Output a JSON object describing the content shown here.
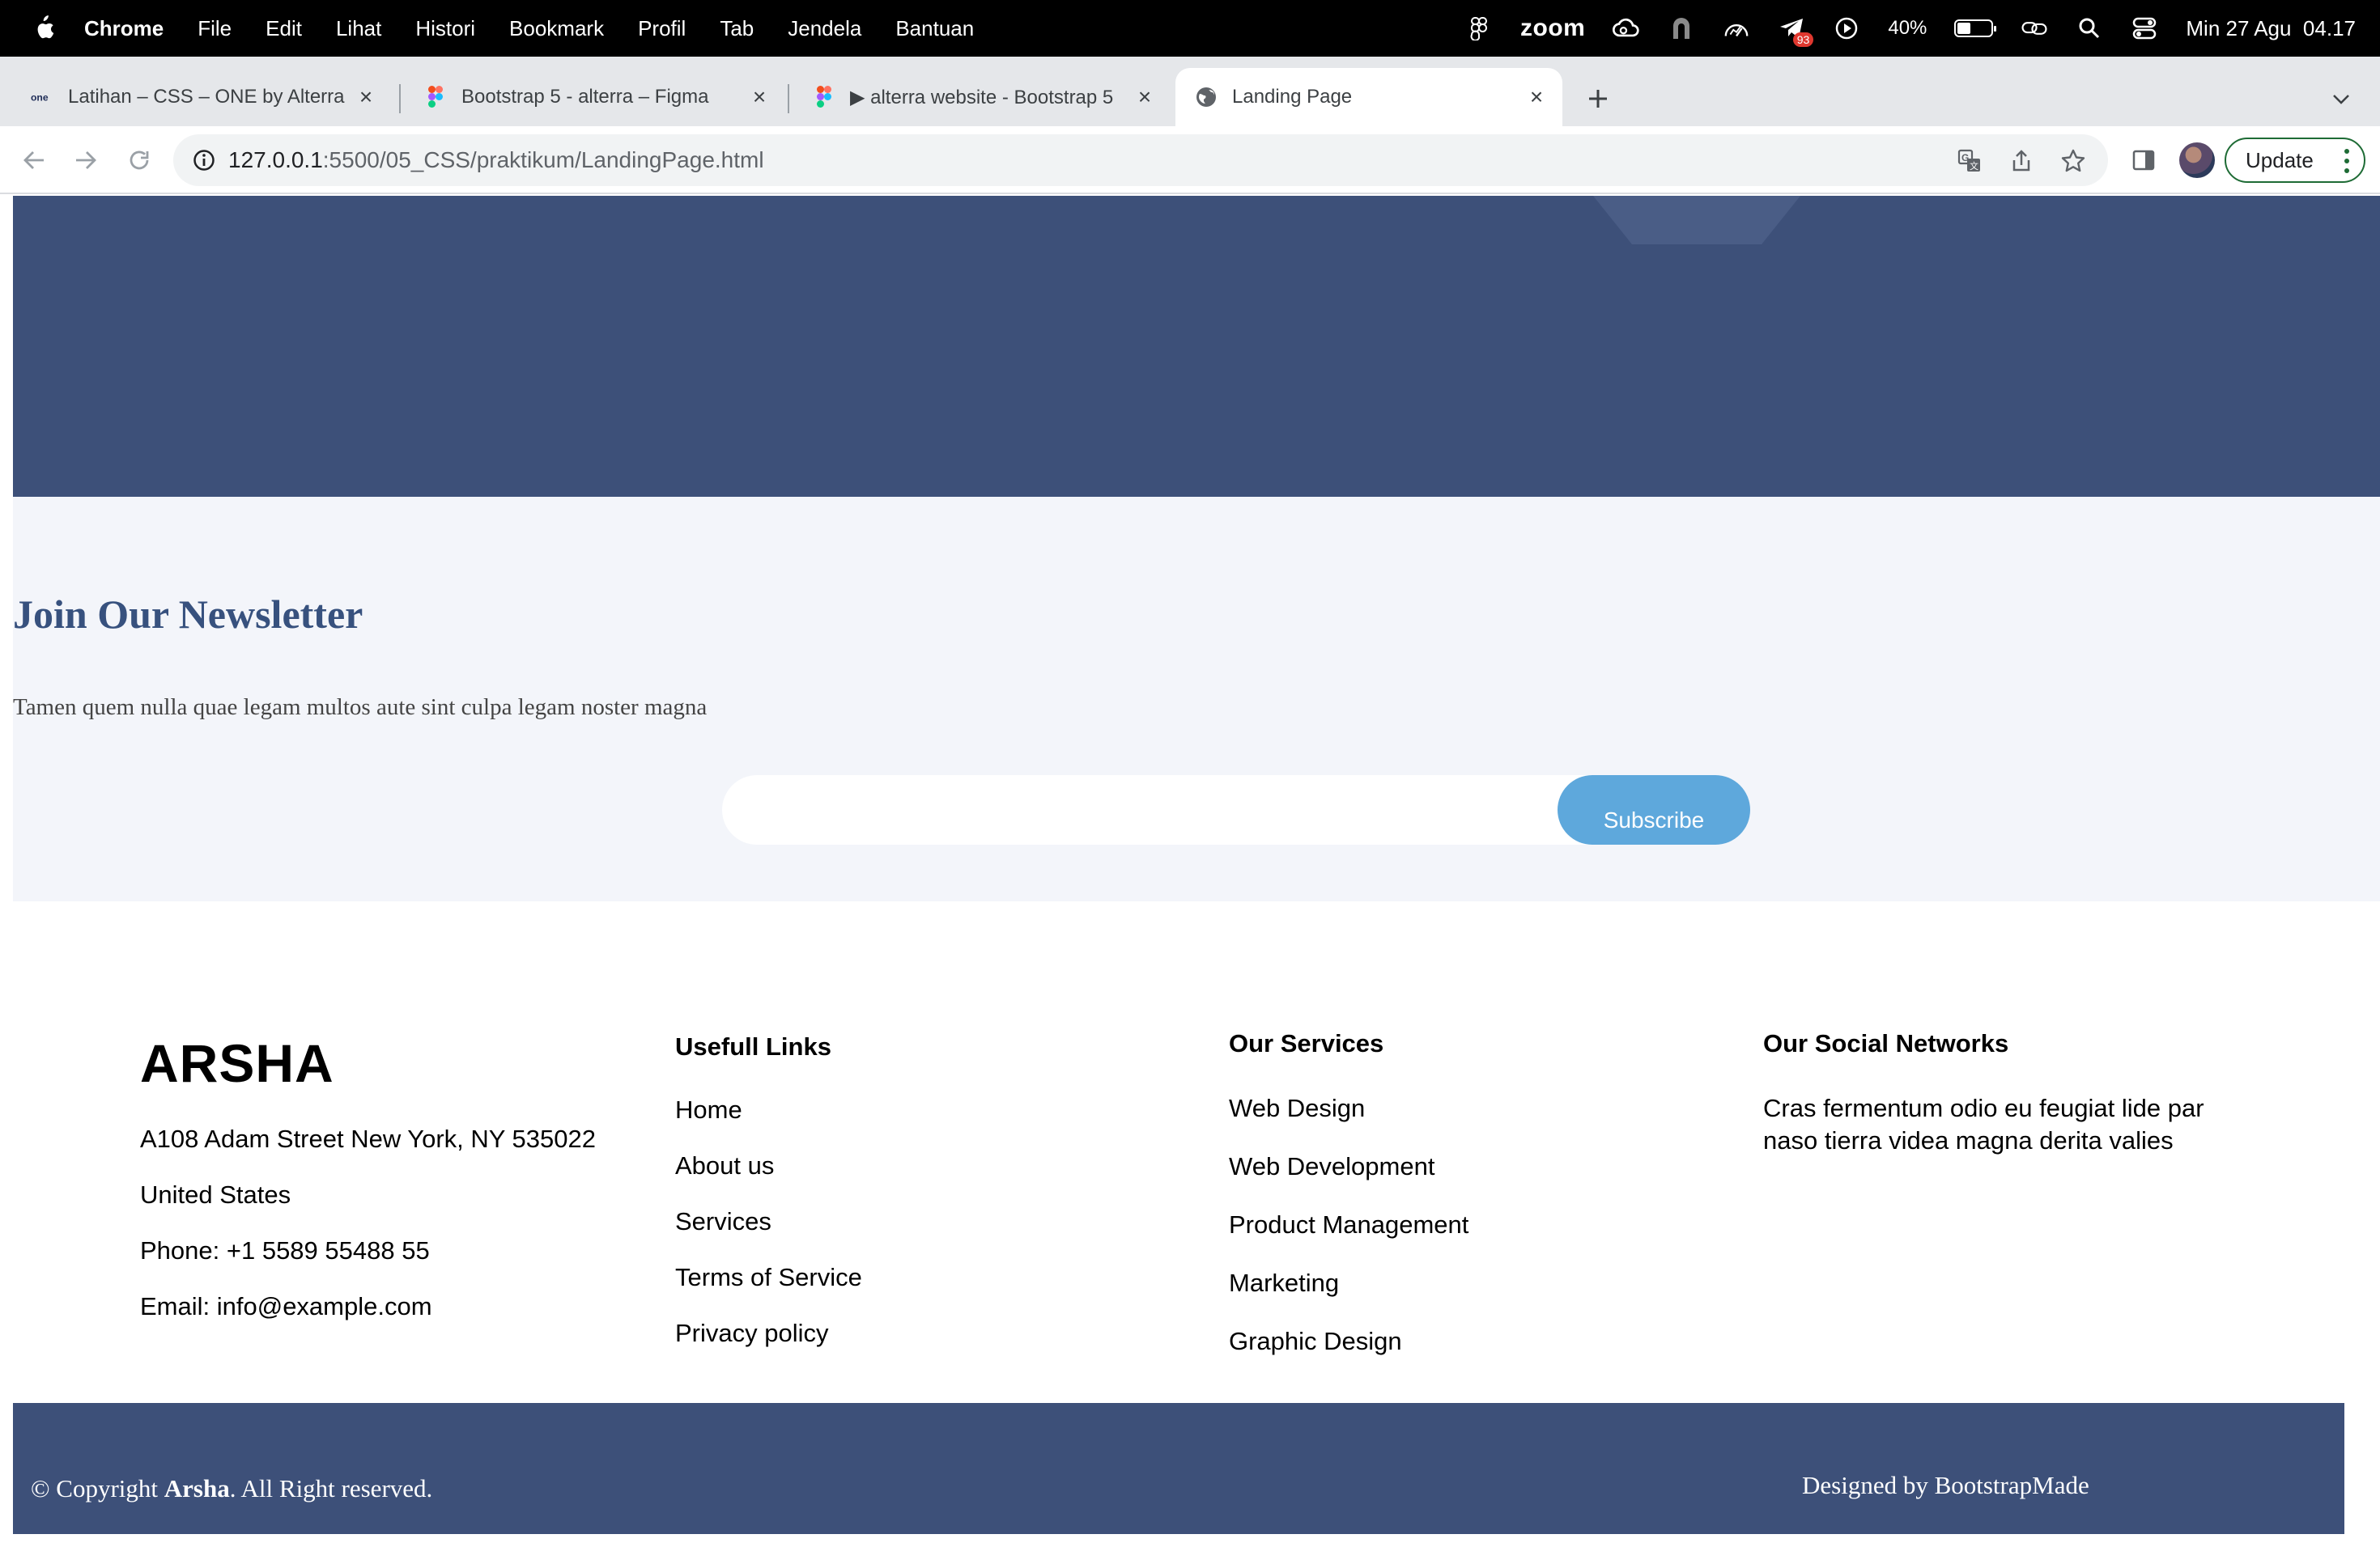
{
  "menubar": {
    "app_name": "Chrome",
    "menus": [
      "File",
      "Edit",
      "Lihat",
      "Histori",
      "Bookmark",
      "Profil",
      "Tab",
      "Jendela",
      "Bantuan"
    ],
    "zoom_label": "zoom",
    "notification_badge": "93",
    "battery_percent_label": "40%",
    "battery_level": 0.4,
    "clock": "Min 27 Agu  04.17"
  },
  "tabs": [
    {
      "title": "Latihan – CSS – ONE by Alterra",
      "favicon": "alterra-one-icon"
    },
    {
      "title": "Bootstrap 5 - alterra – Figma",
      "favicon": "figma-icon"
    },
    {
      "title": "▶ alterra website - Bootstrap 5",
      "favicon": "figma-icon"
    },
    {
      "title": "Landing Page",
      "favicon": "globe-icon",
      "active": true
    }
  ],
  "toolbar": {
    "url_host": "127.0.0.1",
    "url_path": ":5500/05_CSS/praktikum/LandingPage.html",
    "update_label": "Update"
  },
  "newsletter": {
    "title": "Join Our Newsletter",
    "subtitle": "Tamen quem nulla quae legam multos aute sint culpa legam noster magna",
    "email_placeholder": "",
    "subscribe_label": "Subscribe"
  },
  "footer": {
    "brand": "ARSHA",
    "address_lines": [
      "A108 Adam Street New York, NY 535022",
      "United States",
      "Phone: +1 5589 55488 55",
      "Email: info@example.com"
    ],
    "useful_links": {
      "title": "Usefull Links",
      "items": [
        "Home",
        "About us",
        "Services",
        "Terms of Service",
        "Privacy policy"
      ]
    },
    "services": {
      "title": "Our Services",
      "items": [
        "Web Design",
        "Web Development",
        "Product Management",
        "Marketing",
        "Graphic Design"
      ]
    },
    "social": {
      "title": "Our Social Networks",
      "text": "Cras fermentum odio eu feugiat lide par naso tierra videa magna derita valies"
    },
    "copyright_prefix": "© Copyright ",
    "copyright_brand": "Arsha",
    "copyright_suffix": ". All Right reserved.",
    "credits": "Designed by BootstrapMade"
  },
  "colors": {
    "primary_navy": "#3d5079",
    "heading_blue": "#37517e",
    "subscribe_blue": "#5ea8dc",
    "newsletter_bg": "#f3f5fa"
  }
}
